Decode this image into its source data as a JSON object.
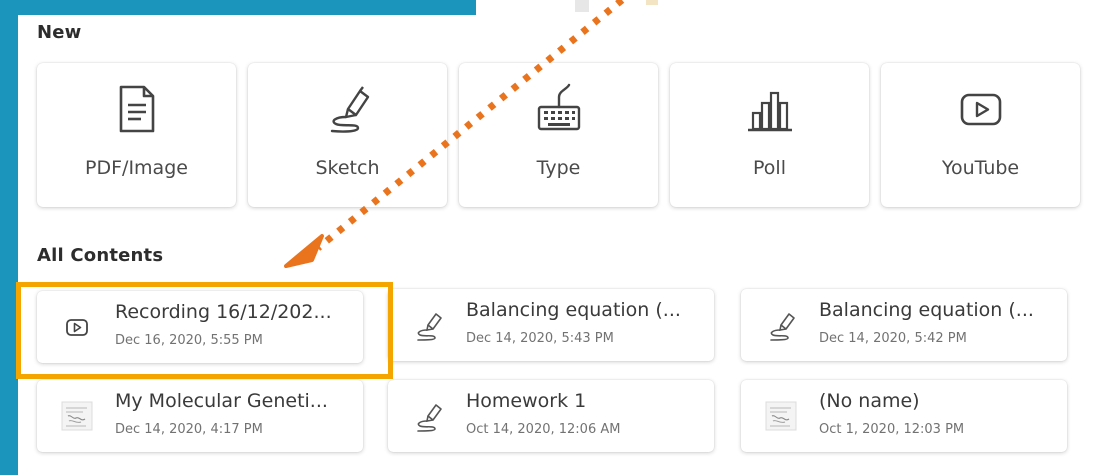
{
  "new_section": {
    "title": "New",
    "items": [
      {
        "label": "PDF/Image",
        "icon": "document-icon"
      },
      {
        "label": "Sketch",
        "icon": "pen-sketch-icon"
      },
      {
        "label": "Type",
        "icon": "keyboard-icon"
      },
      {
        "label": "Poll",
        "icon": "bar-chart-icon"
      },
      {
        "label": "YouTube",
        "icon": "play-button-icon"
      }
    ]
  },
  "contents_section": {
    "title": "All Contents",
    "items": [
      {
        "title": "Recording 16/12/202...",
        "date": "Dec 16, 2020, 5:55 PM",
        "icon": "play-button-icon",
        "highlighted": true
      },
      {
        "title": "Balancing equation (...",
        "date": "Dec 14, 2020, 5:43 PM",
        "icon": "pen-sketch-icon"
      },
      {
        "title": "Balancing equation (...",
        "date": "Dec 14, 2020, 5:42 PM",
        "icon": "pen-sketch-icon"
      },
      {
        "title": "My Molecular Geneti...",
        "date": "Dec 14, 2020, 4:17 PM",
        "icon": "document-thumbnail-icon"
      },
      {
        "title": "Homework 1",
        "date": "Oct 14, 2020, 12:06 AM",
        "icon": "pen-sketch-icon"
      },
      {
        "title": "(No name)",
        "date": "Oct 1, 2020, 12:03 PM",
        "icon": "document-thumbnail-icon"
      }
    ]
  },
  "colors": {
    "frame": "#1c95bd",
    "highlight": "#f5a500",
    "arrow": "#e9741d"
  }
}
